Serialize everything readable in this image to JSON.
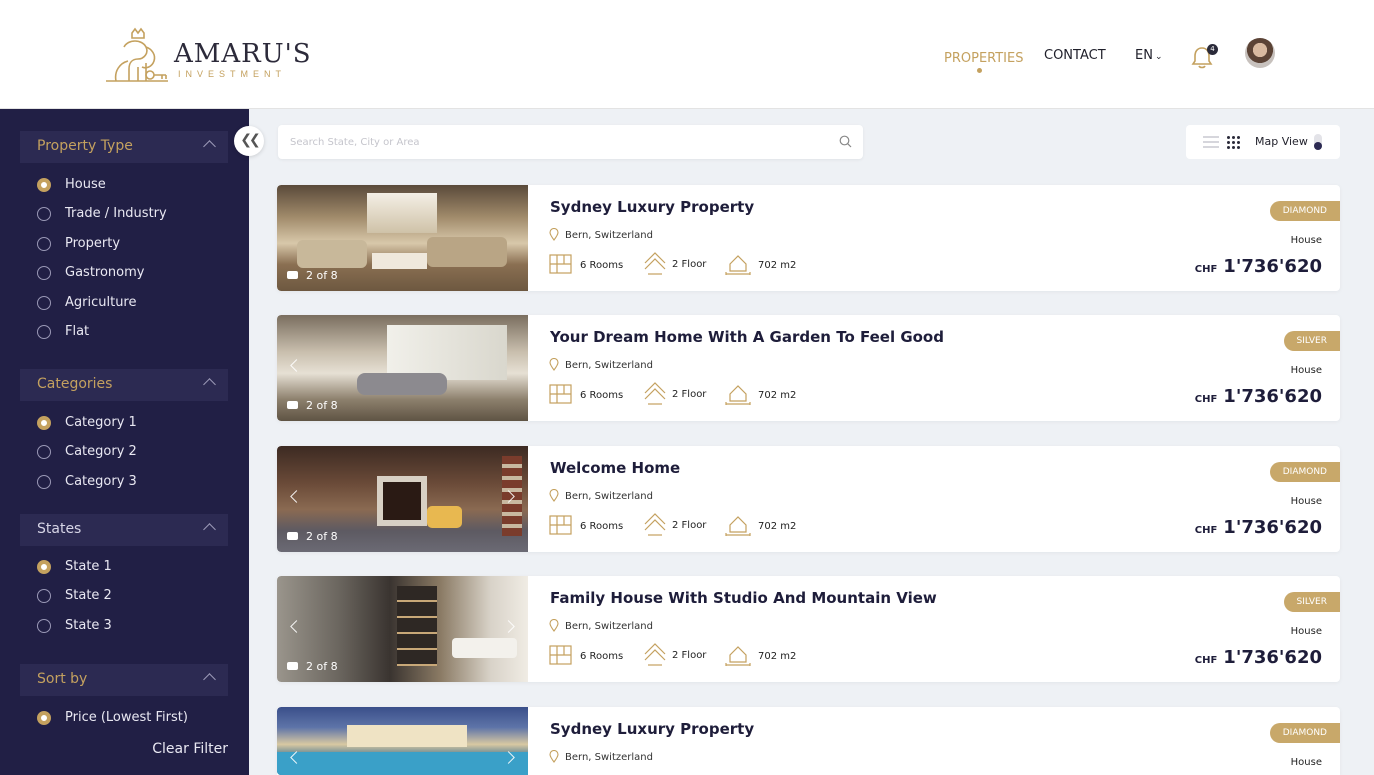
{
  "brand": {
    "name": "AMARU'S",
    "tagline": "INVESTMENT"
  },
  "nav": {
    "properties": "PROPERTIES",
    "contact": "CONTACT",
    "language": "EN",
    "notifications_count": "4"
  },
  "sidebar": {
    "property_type": {
      "title": "Property Type",
      "options": [
        "House",
        "Trade / Industry",
        "Property",
        "Gastronomy",
        "Agriculture",
        "Flat"
      ],
      "selected": "House"
    },
    "categories": {
      "title": "Categories",
      "options": [
        "Category 1",
        "Category 2",
        "Category 3"
      ],
      "selected": "Category 1"
    },
    "states": {
      "title": "States",
      "options": [
        "State 1",
        "State 2",
        "State 3"
      ],
      "selected": "State 1"
    },
    "sort_by": {
      "title": "Sort by",
      "options": [
        "Price (Lowest First)"
      ],
      "selected": "Price (Lowest First)"
    },
    "clear_filter": "Clear Filter"
  },
  "search": {
    "placeholder": "Search State, City or Area"
  },
  "view": {
    "map_label": "Map View"
  },
  "listings": [
    {
      "title": "Sydney Luxury Property",
      "location": "Bern, Switzerland",
      "rooms": "6 Rooms",
      "floor": "2 Floor",
      "area": "702 m2",
      "tier": "DIAMOND",
      "type": "House",
      "currency": "CHF",
      "price": "1'736'620",
      "photo_count": "2 of 8"
    },
    {
      "title": "Your Dream Home With A Garden To Feel Good",
      "location": "Bern, Switzerland",
      "rooms": "6 Rooms",
      "floor": "2 Floor",
      "area": "702 m2",
      "tier": "SILVER",
      "type": "House",
      "currency": "CHF",
      "price": "1'736'620",
      "photo_count": "2 of 8"
    },
    {
      "title": "Welcome Home",
      "location": "Bern, Switzerland",
      "rooms": "6 Rooms",
      "floor": "2 Floor",
      "area": "702 m2",
      "tier": "DIAMOND",
      "type": "House",
      "currency": "CHF",
      "price": "1'736'620",
      "photo_count": "2 of 8"
    },
    {
      "title": "Family House With Studio And Mountain View",
      "location": "Bern, Switzerland",
      "rooms": "6 Rooms",
      "floor": "2 Floor",
      "area": "702 m2",
      "tier": "SILVER",
      "type": "House",
      "currency": "CHF",
      "price": "1'736'620",
      "photo_count": "2 of 8"
    },
    {
      "title": "Sydney Luxury Property",
      "location": "Bern, Switzerland",
      "tier": "DIAMOND",
      "type": "House"
    }
  ],
  "colors": {
    "accent": "#c4a15f",
    "sidebar": "#211f45",
    "sidebar_header": "#2c2a52",
    "heading": "#1e1d3a",
    "tier_badge": "#c8a86a"
  }
}
